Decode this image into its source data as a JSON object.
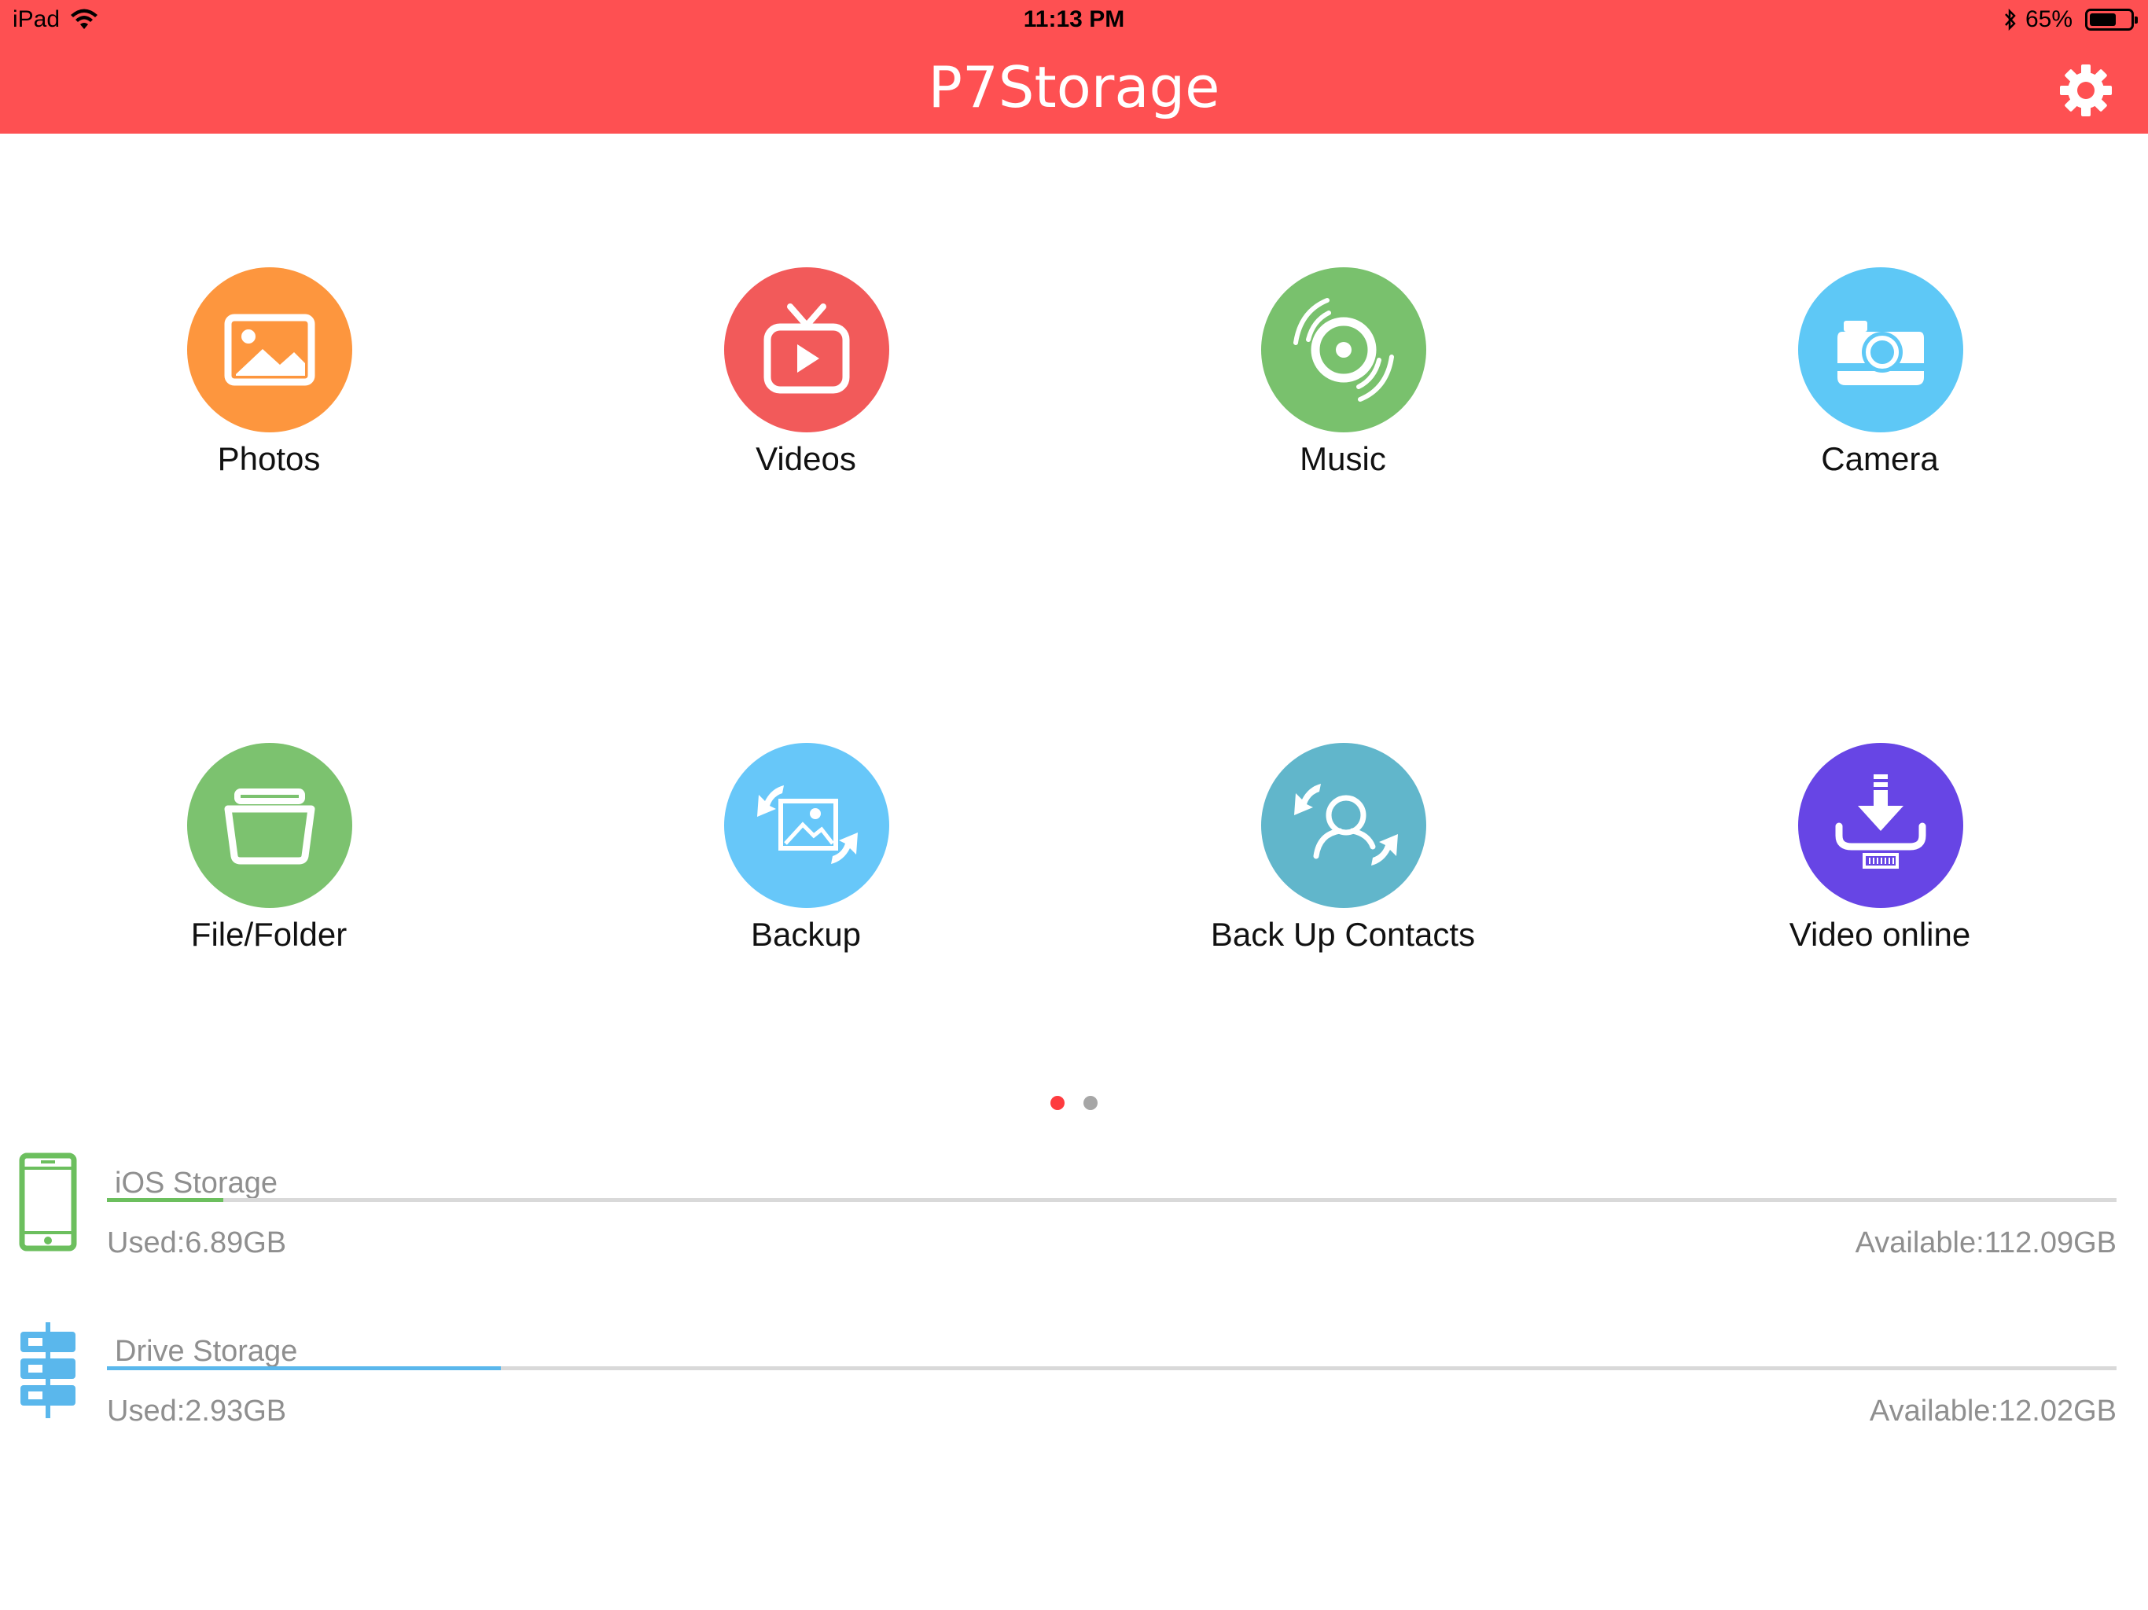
{
  "status_bar": {
    "device": "iPad",
    "time": "11:13 PM",
    "battery_text": "65%",
    "battery_level": 0.65
  },
  "header": {
    "title": "P7Storage",
    "bg_color": "#fe5052"
  },
  "tiles": [
    {
      "label": "Photos",
      "icon": "photo-icon",
      "color": "#fd963e"
    },
    {
      "label": "Videos",
      "icon": "tv-play-icon",
      "color": "#f25a5a"
    },
    {
      "label": "Music",
      "icon": "vinyl-disc-icon",
      "color": "#79c16d"
    },
    {
      "label": "Camera",
      "icon": "camera-icon",
      "color": "#5ec8f6"
    },
    {
      "label": "File/Folder",
      "icon": "folder-icon",
      "color": "#7cc26f"
    },
    {
      "label": "Backup",
      "icon": "backup-image-icon",
      "color": "#67c7f9"
    },
    {
      "label": "Back Up Contacts",
      "icon": "backup-contacts-icon",
      "color": "#61b6cb"
    },
    {
      "label": "Video online",
      "icon": "download-icon",
      "color": "#6745e5"
    }
  ],
  "pager": {
    "active_color": "#fe3b3f",
    "inactive_color": "#a6a6a6",
    "current_page": 1,
    "page_count": 2
  },
  "storage": {
    "ios": {
      "name": "iOS Storage",
      "used": "Used:6.89GB",
      "available": "Available:112.09GB",
      "used_fraction": 0.058,
      "color": "#6cbf5e",
      "icon": "phone-icon"
    },
    "drive": {
      "name": "Drive Storage",
      "used": "Used:2.93GB",
      "available": "Available:12.02GB",
      "used_fraction": 0.196,
      "color": "#5ab7ec",
      "icon": "server-icon"
    }
  }
}
